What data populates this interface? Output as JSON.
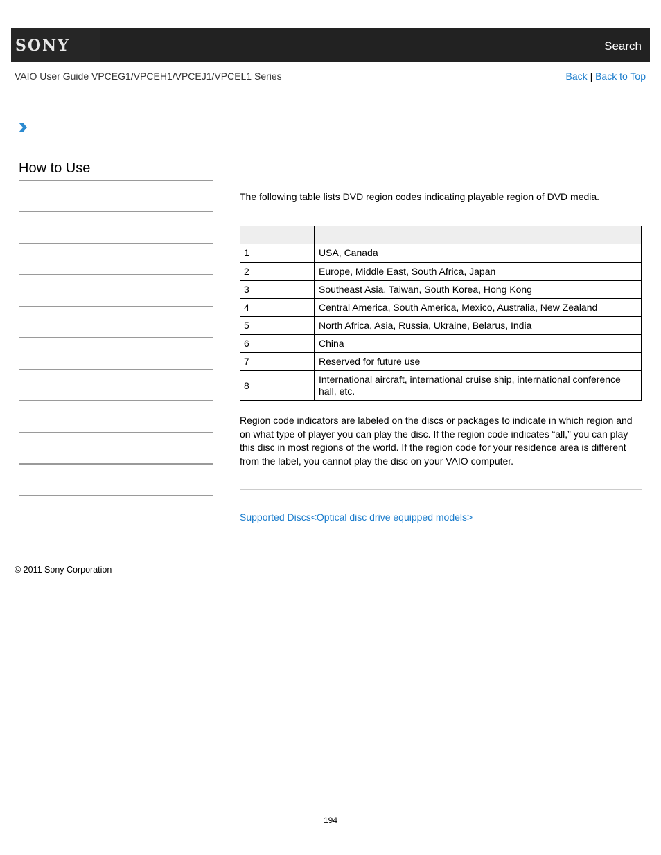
{
  "header": {
    "logo": "SONY",
    "search_label": "Search"
  },
  "subheader": {
    "guide_title": "VAIO User Guide VPCEG1/VPCEH1/VPCEJ1/VPCEL1 Series",
    "back_label": "Back",
    "separator": "|",
    "back_to_top_label": "Back to Top"
  },
  "icons": {
    "breadcrumb": "chevron-right-icon"
  },
  "colors": {
    "header_bg": "#222222",
    "link": "#1a7ccc",
    "chevron": "#2b8ad0",
    "table_header_bg": "#eeeeee",
    "rule": "#9a9a9a"
  },
  "sidebar": {
    "title": "How to Use",
    "item_count": 10
  },
  "main": {
    "intro": "The following table lists DVD region codes indicating playable region of DVD media.",
    "table": {
      "headers": [
        "",
        ""
      ],
      "rows": [
        {
          "code": "1",
          "region": "USA, Canada"
        },
        {
          "code": "2",
          "region": "Europe, Middle East, South Africa, Japan"
        },
        {
          "code": "3",
          "region": "Southeast Asia, Taiwan, South Korea, Hong Kong"
        },
        {
          "code": "4",
          "region": "Central America, South America, Mexico, Australia, New Zealand"
        },
        {
          "code": "5",
          "region": "North Africa, Asia, Russia, Ukraine, Belarus, India"
        },
        {
          "code": "6",
          "region": "China"
        },
        {
          "code": "7",
          "region": "Reserved for future use"
        },
        {
          "code": "8",
          "region": "International aircraft, international cruise ship, international conference hall, etc."
        }
      ]
    },
    "body": "Region code indicators are labeled on the discs or packages to indicate in which region and on what type of player you can play the disc. If the region code indicates “all,” you can play this disc in most regions of the world. If the region code for your residence area is different from the label, you cannot play the disc on your VAIO computer.",
    "related_link": "Supported Discs<Optical disc drive equipped models>"
  },
  "footer": {
    "copyright": "© 2011 Sony Corporation",
    "page_number": "194"
  }
}
